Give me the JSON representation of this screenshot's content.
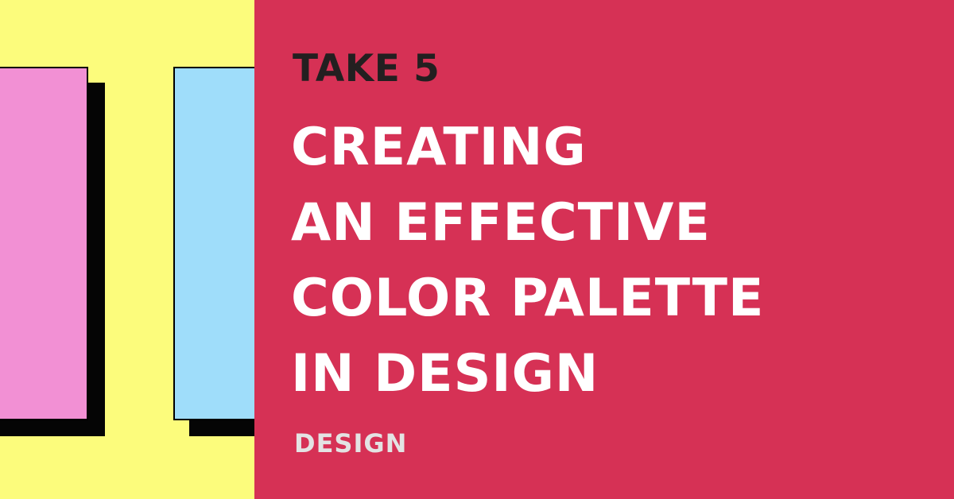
{
  "colors": {
    "left_background": "#fcfc7c",
    "right_background": "#d63155",
    "swatch_pink": "#f290d4",
    "swatch_blue": "#9fddfa",
    "shadow": "#050505",
    "series_text": "#231f20",
    "headline_text": "#ffffff",
    "category_text": "#e3e3e3"
  },
  "series_label": "TAKE 5",
  "headline": {
    "lines": [
      "CREATING",
      "AN EFFECTIVE",
      "COLOR PALETTE",
      "IN DESIGN"
    ]
  },
  "category": "DESIGN"
}
